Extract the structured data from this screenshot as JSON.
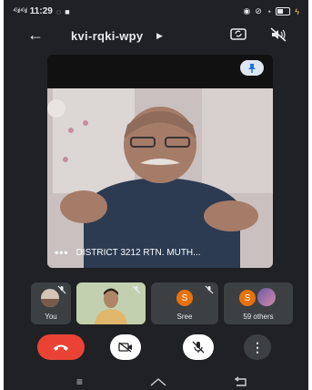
{
  "status_bar": {
    "signal": "⁴ᴳ.ıl ⁴ᴳ.ıl",
    "time": "11:29"
  },
  "topbar": {
    "meeting_code": "kvi-rqki-wpy"
  },
  "main_video": {
    "speaker_name": "DISTRICT 3212 RTN. MUTH..."
  },
  "participants": [
    {
      "label": "You"
    },
    {
      "label": ""
    },
    {
      "label": "Sree",
      "initial": "S"
    },
    {
      "label": "59 others",
      "initial": "S"
    }
  ],
  "colors": {
    "background": "#202124",
    "end_call": "#ea4335",
    "avatar_orange": "#e8710a",
    "tile": "#3c4043"
  },
  "icons": [
    "back-arrow-icon",
    "switch-camera-icon",
    "speaker-off-icon",
    "pin-icon",
    "mic-off-icon",
    "end-call-icon",
    "camera-off-icon",
    "more-icon"
  ]
}
